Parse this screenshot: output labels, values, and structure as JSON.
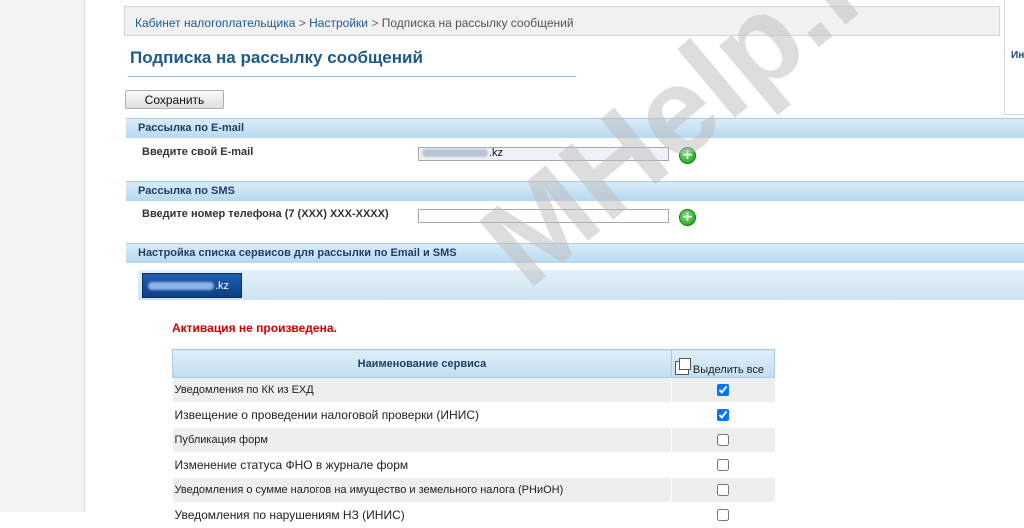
{
  "breadcrumb": {
    "items": [
      "Кабинет налогоплательщика",
      "Настройки",
      "Подписка на рассылку сообщений"
    ],
    "separator": ">"
  },
  "right_panel": {
    "text": "Ин"
  },
  "page": {
    "title": "Подписка на рассылку сообщений"
  },
  "toolbar": {
    "save_label": "Сохранить"
  },
  "email_section": {
    "title": "Рассылка по E-mail",
    "label": "Введите свой E-mail",
    "value_suffix": ".kz"
  },
  "sms_section": {
    "title": "Рассылка по SMS",
    "label": "Введите номер телефона (7 (XXX) XXX-XXXX)",
    "value": ""
  },
  "services_section": {
    "title": "Настройка списка сервисов для рассылки по Email и SMS",
    "email_tab_suffix": ".kz",
    "activation_status": "Активация не произведена.",
    "table": {
      "col_name": "Наименование сервиса",
      "col_select": "Выделить все",
      "rows": [
        {
          "name": "Уведомления по КК из ЕХД",
          "checked": true
        },
        {
          "name": "Извещение о проведении налоговой проверки (ИНИС)",
          "checked": true
        },
        {
          "name": "Публикация форм",
          "checked": false
        },
        {
          "name": "Изменение статуса ФНО в журнале форм",
          "checked": false
        },
        {
          "name": "Уведомления о сумме налогов на имущество и земельного налога (РНиОН)",
          "checked": false
        },
        {
          "name": "Уведомления по нарушениям НЗ (ИНИС)",
          "checked": false
        }
      ]
    }
  },
  "watermark": {
    "text": "MHelp.kz"
  },
  "colors": {
    "accent": "#1c5a8c",
    "section_bar": "#c7e1f3",
    "error": "#d40000",
    "add_button": "#1a9a1a",
    "email_tab": "#174f9e"
  },
  "icons": {
    "add": "plus-circle-icon",
    "select_all": "select-all-icon"
  }
}
